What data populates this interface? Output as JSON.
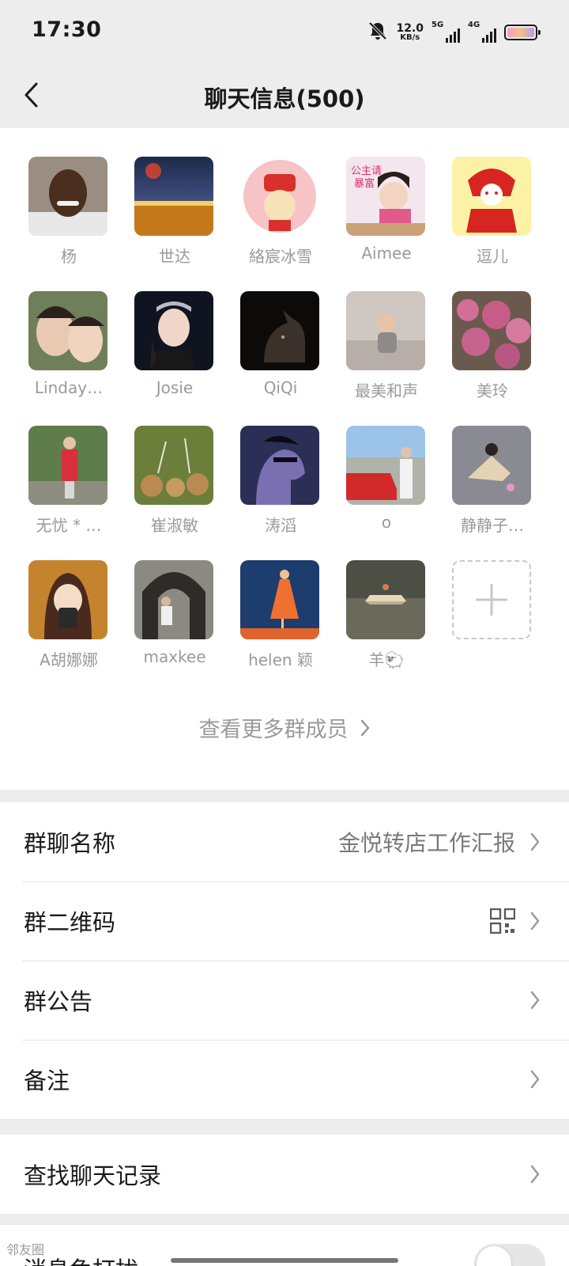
{
  "status": {
    "time": "17:30",
    "net_speed_value": "12.0",
    "net_speed_unit": "KB/s",
    "sig1_label": "5G",
    "sig2_label": "4G"
  },
  "nav": {
    "title": "聊天信息(500)"
  },
  "members": [
    {
      "name": "杨"
    },
    {
      "name": "世达"
    },
    {
      "name": "絡宸冰雪"
    },
    {
      "name": "Aimee"
    },
    {
      "name": "逗儿"
    },
    {
      "name": "Linday…"
    },
    {
      "name": "Josie"
    },
    {
      "name": "QiQi"
    },
    {
      "name": "最美和声"
    },
    {
      "name": "美玲"
    },
    {
      "name": "无忧 * …"
    },
    {
      "name": "崔淑敏"
    },
    {
      "name": "涛滔"
    },
    {
      "name": "o"
    },
    {
      "name": "静静子…"
    },
    {
      "name": "A胡娜娜"
    },
    {
      "name": "maxkee"
    },
    {
      "name": "helen 颖"
    },
    {
      "name": "羊🐑"
    }
  ],
  "avatar_texts": {
    "aimee_line1": "公主请",
    "aimee_line2": "暴富"
  },
  "more_members": "查看更多群成员",
  "settings": {
    "group_name_label": "群聊名称",
    "group_name_value": "金悦转店工作汇报",
    "qr_label": "群二维码",
    "notice_label": "群公告",
    "remark_label": "备注",
    "search_label": "查找聊天记录",
    "mute_label": "消息免打扰"
  },
  "watermark": "邻友圈"
}
